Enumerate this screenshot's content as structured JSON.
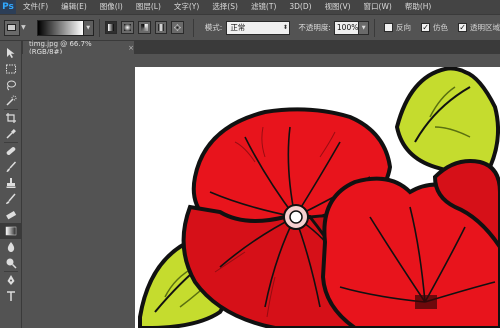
{
  "app": {
    "logo": "Ps"
  },
  "menu": [
    {
      "label": "文件(F)"
    },
    {
      "label": "编辑(E)"
    },
    {
      "label": "图像(I)"
    },
    {
      "label": "图层(L)"
    },
    {
      "label": "文字(Y)"
    },
    {
      "label": "选择(S)"
    },
    {
      "label": "滤镜(T)"
    },
    {
      "label": "3D(D)"
    },
    {
      "label": "视图(V)"
    },
    {
      "label": "窗口(W)"
    },
    {
      "label": "帮助(H)"
    }
  ],
  "options": {
    "mode_label": "模式:",
    "mode_value": "正常",
    "opacity_label": "不透明度:",
    "opacity_value": "100%",
    "reverse_label": "反向",
    "dither_label": "仿色",
    "transparency_label": "透明区域",
    "reverse_checked": false,
    "dither_checked": true,
    "transparency_checked": true
  },
  "document": {
    "tab_title": "timg.jpg @ 66.7%(RGB/8#)",
    "close_symbol": "×"
  },
  "tools": [
    "move-tool-icon",
    "marquee-tool-icon",
    "lasso-tool-icon",
    "quick-select-tool-icon",
    "crop-tool-icon",
    "eyedropper-tool-icon",
    "healing-brush-tool-icon",
    "brush-tool-icon",
    "clone-stamp-tool-icon",
    "history-brush-tool-icon",
    "eraser-tool-icon",
    "gradient-tool-icon",
    "blur-tool-icon",
    "dodge-tool-icon",
    "pen-tool-icon",
    "type-tool-icon"
  ],
  "colors": {
    "menubar": "#444444",
    "panel": "#535353",
    "petal_red": "#e8141c",
    "leaf_green": "#b8d42a",
    "outline": "#111111"
  }
}
